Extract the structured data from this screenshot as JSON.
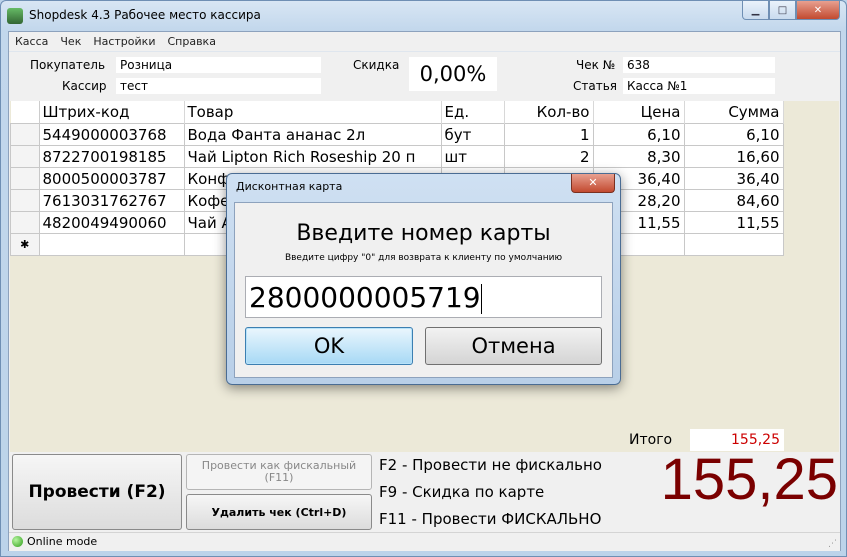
{
  "window": {
    "title": "Shopdesk 4.3 Рабочее место кассира",
    "minimize_glyph": "▁",
    "maximize_glyph": "□",
    "close_glyph": "✕"
  },
  "menu": [
    "Касса",
    "Чек",
    "Настройки",
    "Справка"
  ],
  "header": {
    "buyer_label": "Покупатель",
    "buyer_value": "Розница",
    "cashier_label": "Кассир",
    "cashier_value": "тест",
    "discount_label": "Скидка",
    "discount_value": "0,00%",
    "check_label": "Чек №",
    "check_value": "638",
    "article_label": "Статья",
    "article_value": "Касса №1"
  },
  "table": {
    "columns": [
      "Штрих-код",
      "Товар",
      "Ед.",
      "Кол-во",
      "Цена",
      "Сумма"
    ],
    "rows": [
      [
        "5449000003768",
        "Вода Фанта ананас 2л",
        "бут",
        "1",
        "6,10",
        "6,10"
      ],
      [
        "8722700198185",
        "Чай Lipton Rich Roseship 20 п",
        "шт",
        "2",
        "8,30",
        "16,60"
      ],
      [
        "8000500003787",
        "Конф",
        "",
        "",
        "36,40",
        "36,40"
      ],
      [
        "7613031762767",
        "Кофе",
        "",
        "",
        "28,20",
        "84,60"
      ],
      [
        "4820049490060",
        "Чай А",
        "",
        "",
        "11,55",
        "11,55"
      ]
    ],
    "new_row_marker": "✱"
  },
  "totals": {
    "label": "Итого",
    "value": "155,25",
    "big_value": "155,25"
  },
  "buttons": {
    "post": "Провести (F2)",
    "post_fiscal": "Провести как фискальный (F11)",
    "delete_check": "Удалить чек (Ctrl+D)"
  },
  "hints": [
    "F2 - Провести не фискально",
    "F9 - Скидка по карте",
    "F11 - Провести ФИСКАЛЬНО"
  ],
  "status": {
    "mode": "Online mode"
  },
  "dialog": {
    "title": "Дисконтная карта",
    "close_glyph": "✕",
    "heading": "Введите номер карты",
    "subtitle": "Введите цифру \"0\" для возврата к клиенту по умолчанию",
    "input_value": "2800000005719",
    "ok_label": "OK",
    "cancel_label": "Отмена"
  },
  "colors": {
    "total_small": "#cc0000",
    "total_big": "#7a0000",
    "status_online": "#2f9d1a"
  }
}
